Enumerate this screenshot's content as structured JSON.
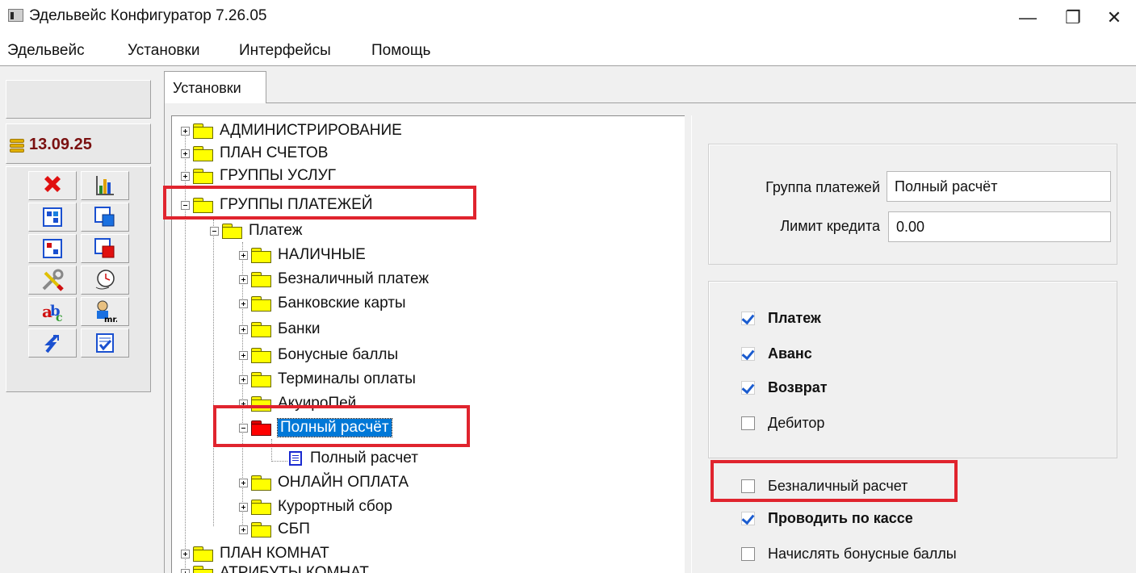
{
  "window": {
    "title": "Эдельвейс Конфигуратор 7.26.05",
    "minimize": "—",
    "maximize": "❐",
    "close": "✕"
  },
  "menu": [
    "Эдельвейс",
    "Установки",
    "Интерфейсы",
    "Помощь"
  ],
  "sidebar": {
    "date": "13.09.25",
    "icons": [
      "delete-x-icon",
      "chart-icon",
      "grid-icon",
      "grid-blue-icon",
      "grid-red-icon",
      "grid-red2-icon",
      "tools-icon",
      "clock-icon",
      "abc-icon",
      "user-icon",
      "refresh-icon",
      "checklist-icon"
    ]
  },
  "tab": {
    "label": "Установки"
  },
  "tree": {
    "admin": "АДМИНИСТРИРОВАНИЕ",
    "accounts": "ПЛАН СЧЕТОВ",
    "service_groups": "ГРУППЫ УСЛУГ",
    "payment_groups": "ГРУППЫ ПЛАТЕЖЕЙ",
    "payment": "Платеж",
    "cash": "НАЛИЧНЫЕ",
    "cashless": "Безналичный платеж",
    "bank_cards": "Банковские карты",
    "banks": "Банки",
    "bonus": "Бонусные баллы",
    "terminals": "Терминалы оплаты",
    "acquiropay": "АкуироПей",
    "full_calc": "Полный расчёт",
    "full_calc_item": "Полный расчет",
    "online": "ОНЛАЙН ОПЛАТА",
    "resort_fee": "Курортный сбор",
    "sbp": "СБП",
    "rooms": "ПЛАН КОМНАТ",
    "partial": "АТРИБУТЫ КОМНАТ"
  },
  "form": {
    "group_label": "Группа платежей",
    "group_value": "Полный расчёт",
    "limit_label": "Лимит кредита",
    "limit_value": "0.00"
  },
  "checkboxes": {
    "payment": {
      "label": "Платеж",
      "checked": true
    },
    "advance": {
      "label": "Аванс",
      "checked": true
    },
    "refund": {
      "label": "Возврат",
      "checked": true
    },
    "debtor": {
      "label": "Дебитор",
      "checked": false
    },
    "cashless_calc": {
      "label": "Безналичный расчет",
      "checked": false
    },
    "via_register": {
      "label": "Проводить по кассе",
      "checked": true
    },
    "accrue_bonus": {
      "label": "Начислять бонусные баллы",
      "checked": false
    }
  },
  "colors": {
    "highlight": "#e0242e",
    "selection": "#0078d7",
    "date": "#7a1010"
  }
}
